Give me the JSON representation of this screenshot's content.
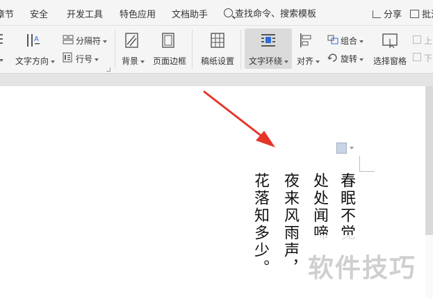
{
  "tabs": [
    "章节",
    "安全",
    "开发工具",
    "特色应用",
    "文档助手"
  ],
  "search": {
    "label": "查找命令、搜索模板"
  },
  "right_actions": {
    "share": "分享",
    "comment": "批注"
  },
  "ribbon": {
    "text_direction": "文字方向",
    "separator": "分隔符",
    "line_number": "行号",
    "background": "背景",
    "page_border": "页面边框",
    "manuscript": "稿纸设置",
    "text_wrap": "文字环绕",
    "align": "对齐",
    "group": "组合",
    "rotate": "旋转",
    "selection_pane": "选择窗格",
    "up": "上",
    "down": "下"
  },
  "poem": {
    "col1": "春眠不觉",
    "col2": "处处闻啼",
    "col3": "夜来风雨声，",
    "col4": "花落知多少。"
  },
  "watermark": "软件技巧",
  "colors": {
    "arrow": "#e53528",
    "accent": "#2d6bd6"
  }
}
